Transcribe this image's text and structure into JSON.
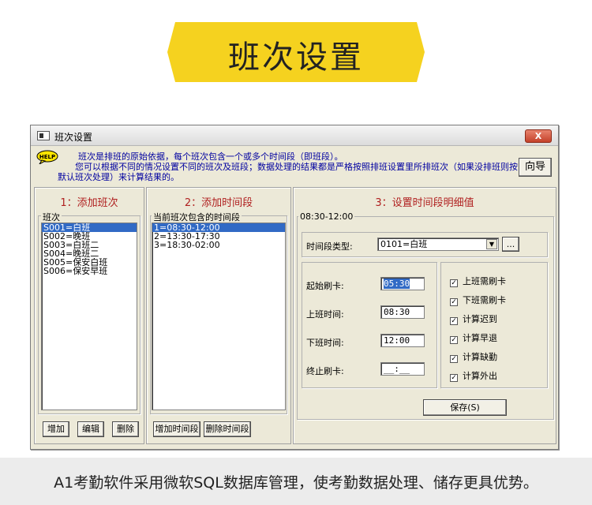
{
  "banner": {
    "title": "班次设置",
    "color": "#f5d21f"
  },
  "window": {
    "title": "班次设置",
    "close_label": "X",
    "help_lines": [
      "班次是排班的原始依据，每个班次包含一个或多个时间段（即班段）。",
      "您可以根据不同的情况设置不同的班次及班段；数据处理的结果都是严格按照排班设置里所排班次（如果没排班则按",
      "默认班次处理）来计算结果的。"
    ],
    "wizard_label": "向导"
  },
  "panel1": {
    "title": "1：添加班次",
    "group_label": "班次",
    "items": [
      "S001=白班",
      "S002=晚班",
      "S003=白班二",
      "S004=晚班二",
      "S005=保安白班",
      "S006=保安早班"
    ],
    "selected_index": 0,
    "buttons": {
      "add": "增加",
      "edit": "编辑",
      "delete": "删除"
    }
  },
  "panel2": {
    "title": "2：添加时间段",
    "group_label": "当前班次包含的时间段",
    "items": [
      "1=08:30-12:00",
      "2=13:30-17:30",
      "3=18:30-02:00"
    ],
    "selected_index": 0,
    "buttons": {
      "add": "增加时间段",
      "delete": "删除时间段"
    }
  },
  "panel3": {
    "title": "3：设置时间段明细值",
    "group_label": "08:30-12:00",
    "type_label": "时间段类型:",
    "type_value": "0101=白班",
    "ellipsis_label": "...",
    "fields": {
      "start_swipe_label": "起始刷卡:",
      "start_swipe_value": "05:30",
      "on_duty_label": "上班时间:",
      "on_duty_value": "08:30",
      "off_duty_label": "下班时间:",
      "off_duty_value": "12:00",
      "end_swipe_label": "终止刷卡:",
      "end_swipe_value": "__:__"
    },
    "checks": [
      {
        "label": "上班需刷卡",
        "checked": true
      },
      {
        "label": "下班需刷卡",
        "checked": true
      },
      {
        "label": "计算迟到",
        "checked": true
      },
      {
        "label": "计算早退",
        "checked": true
      },
      {
        "label": "计算缺勤",
        "checked": true
      },
      {
        "label": "计算外出",
        "checked": true
      }
    ],
    "save_label": "保存(S)"
  },
  "footer": {
    "text": "A1考勤软件采用微软SQL数据库管理，使考勤数据处理、储存更具优势。"
  }
}
